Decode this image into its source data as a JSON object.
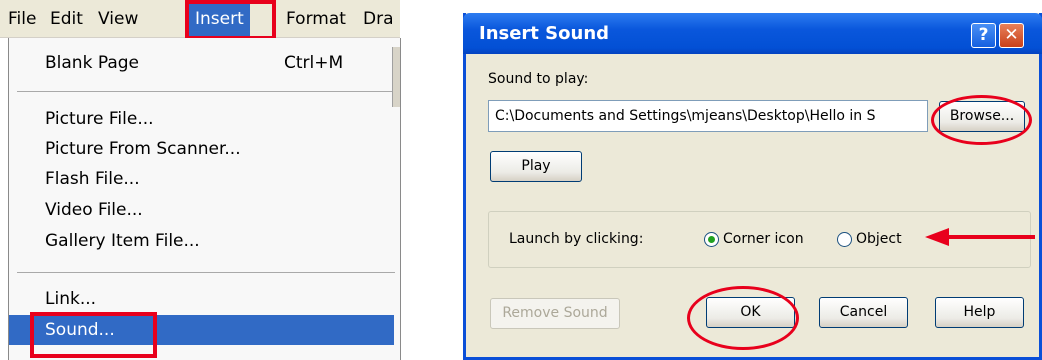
{
  "menubar": {
    "items": [
      "File",
      "Edit",
      "View",
      "Insert",
      "Format",
      "Dra"
    ],
    "active": "Insert"
  },
  "menu": {
    "blank_page": {
      "label": "Blank Page",
      "shortcut": "Ctrl+M"
    },
    "group_media": [
      "Picture File...",
      "Picture From Scanner...",
      "Flash File...",
      "Video File...",
      "Gallery Item File..."
    ],
    "link": "Link...",
    "sound": "Sound..."
  },
  "dialog": {
    "title": "Insert Sound",
    "help_glyph": "?",
    "close_glyph": "✕",
    "sound_label": "Sound to play:",
    "path_value": "C:\\Documents and Settings\\mjeans\\Desktop\\Hello in S",
    "browse_label": "Browse...",
    "play_label": "Play",
    "launch_label": "Launch by clicking:",
    "radio_corner": "Corner icon",
    "radio_object": "Object",
    "selected_radio": "Corner icon",
    "remove_label": "Remove Sound",
    "ok_label": "OK",
    "cancel_label": "Cancel",
    "help_label": "Help"
  },
  "colors": {
    "highlight": "#316ac5",
    "annotation_red": "#e8001c",
    "title_blue": "#0a57dc",
    "dialog_bg": "#ece9d8"
  }
}
